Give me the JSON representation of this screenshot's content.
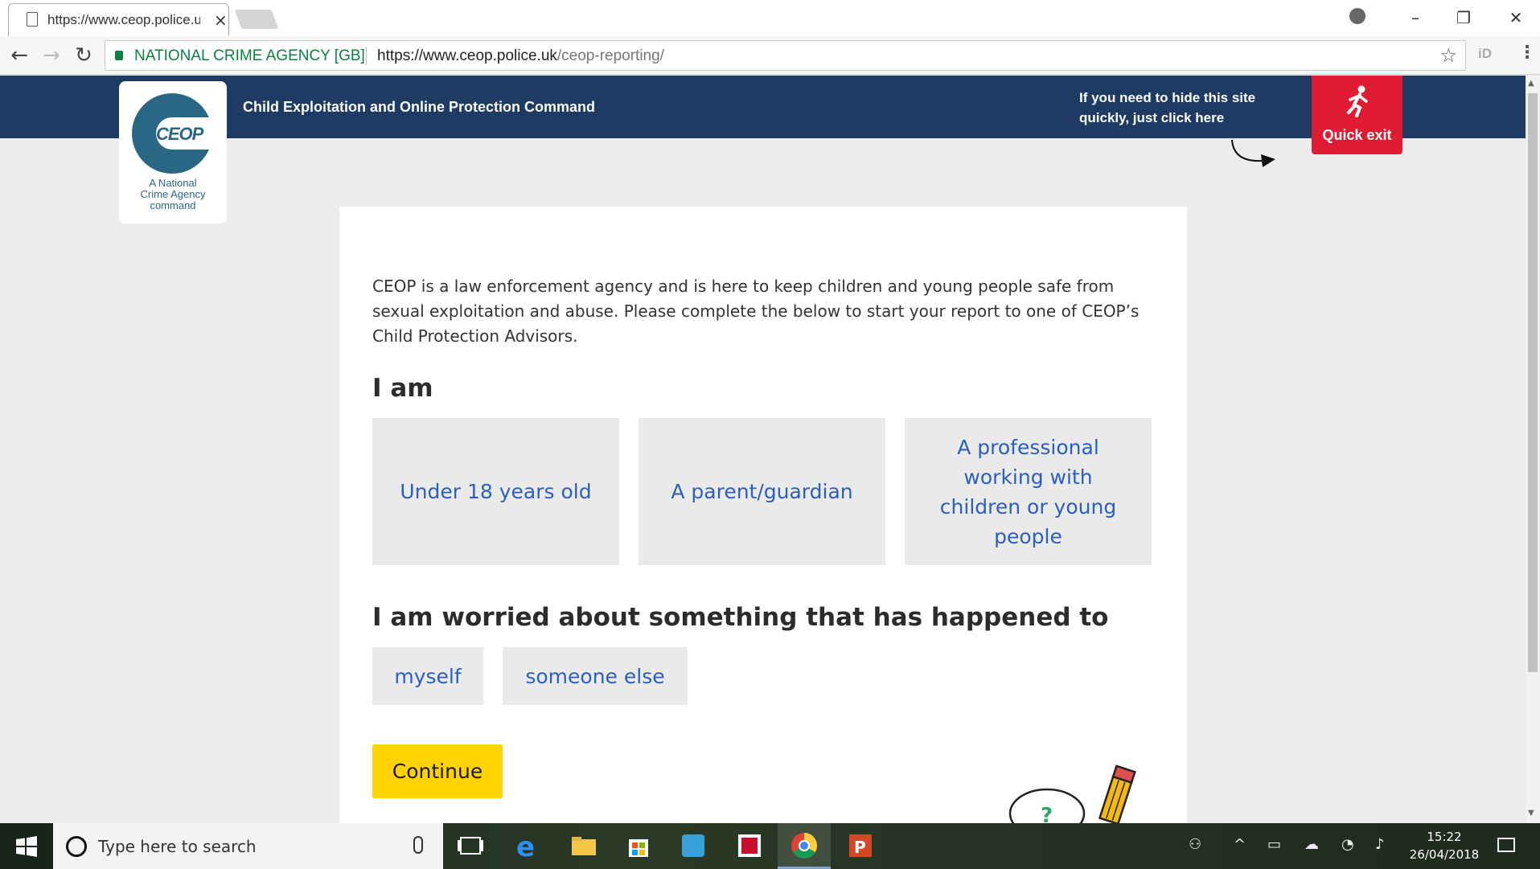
{
  "browser": {
    "tab_title": "https://www.ceop.police.uk/ceop-reporting/",
    "tab_close": "×",
    "window_controls": {
      "minimize": "–",
      "restore": "❐",
      "close": "✕"
    },
    "nav": {
      "back": "←",
      "forward": "→",
      "reload": "↻"
    },
    "site_identity": "NATIONAL CRIME AGENCY [GB]",
    "url_host": "https://www.ceop.police.uk",
    "url_path": "/ceop-reporting/",
    "bookmark_icon": "☆",
    "extension_label": "iD",
    "menu_icon": "⋮"
  },
  "header": {
    "logo_text": "CEOP",
    "logo_sub_line1": "A National",
    "logo_sub_line2": "Crime Agency",
    "logo_sub_line3": "command",
    "title": "Child Exploitation and Online Protection Command",
    "hide_note": "If you need to hide this site quickly, just click here",
    "quick_exit_label": "Quick exit"
  },
  "form": {
    "intro": "CEOP is a law enforcement agency and is here to keep children and young people safe from sexual exploitation and abuse. Please complete the below to start your report to one of CEOP’s Child Protection Advisors.",
    "i_am_heading": "I am",
    "i_am_options": [
      "Under 18 years old",
      "A parent/guardian",
      "A professional working with children or young people"
    ],
    "worried_heading": "I am worried about something that has happened to",
    "worried_options": [
      "myself",
      "someone else"
    ],
    "continue_label": "Continue"
  },
  "taskbar": {
    "search_placeholder": "Type here to search",
    "time": "15:22",
    "date": "26/04/2018"
  },
  "colors": {
    "header_bg": "#1e3b63",
    "quick_exit_bg": "#e01c35",
    "option_text": "#2b5fbf",
    "continue_bg": "#ffd200",
    "logo": "#2a6785"
  }
}
